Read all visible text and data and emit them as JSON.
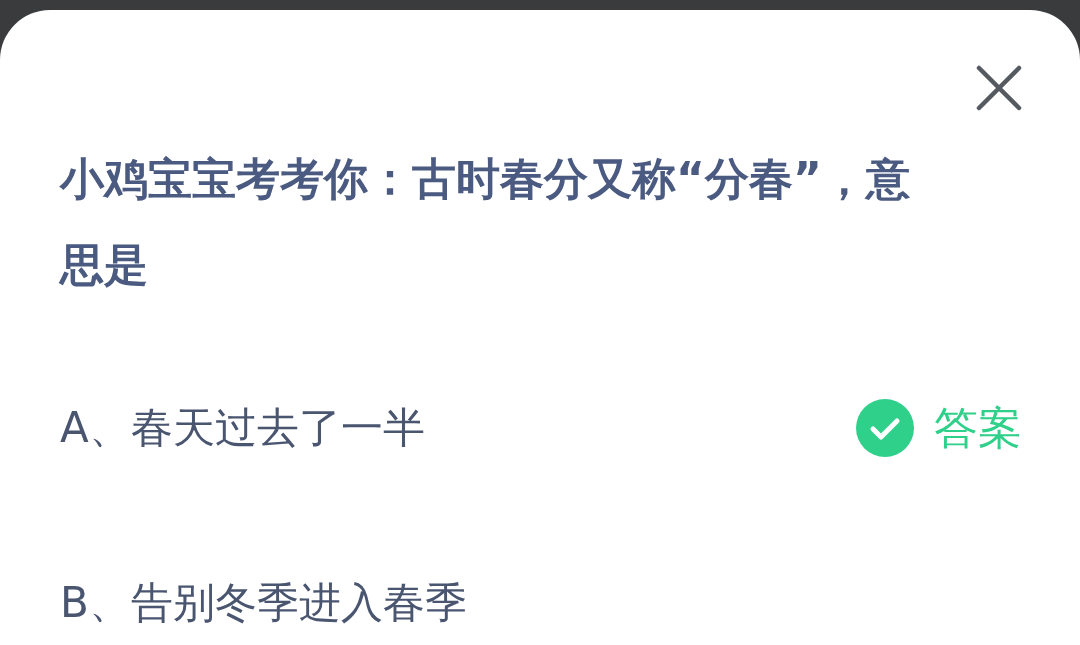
{
  "question": "小鸡宝宝考考你：古时春分又称“分春”，意思是",
  "answer_label": "答案",
  "options": [
    {
      "text": "A、春天过去了一半",
      "correct": true
    },
    {
      "text": "B、告别冬季进入春季",
      "correct": false
    }
  ]
}
